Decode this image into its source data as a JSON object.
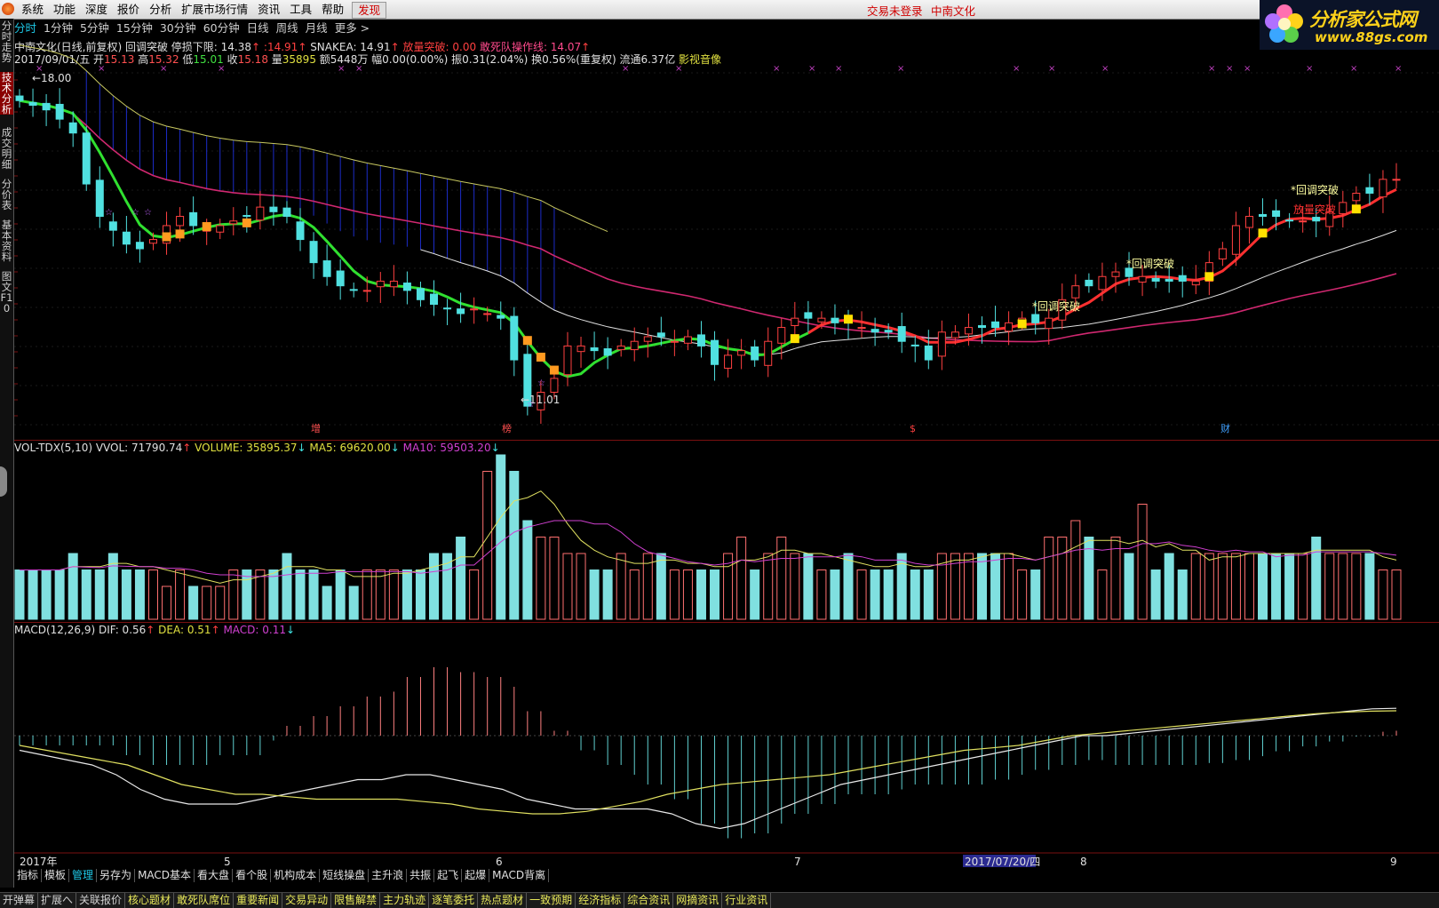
{
  "menu": [
    "系统",
    "功能",
    "深度",
    "报价",
    "分析",
    "扩展市场行情",
    "资讯",
    "工具",
    "帮助"
  ],
  "menu_hot": "发现",
  "notice": "交易未登录",
  "stock_name": "中南文化",
  "brand": {
    "title": "分析家公式网",
    "url": "www.88gs.com"
  },
  "left_tabs": [
    "分时走势",
    "技术分析",
    "成交明细",
    "分价表",
    "基本资料",
    "图文F10"
  ],
  "period_tabs": [
    "分时",
    "1分钟",
    "5分钟",
    "15分钟",
    "30分钟",
    "60分钟",
    "日线",
    "周线",
    "月线",
    "更多 >"
  ],
  "period_active": 0,
  "info1": [
    {
      "t": "中南文化(日线,前复权) 回调突破  停损下限: 14.38",
      "c": "#e0e0e0"
    },
    {
      "t": "↑",
      "c": "#ff4040"
    },
    {
      "t": "  :14.91",
      "c": "#ff4040"
    },
    {
      "t": "↑",
      "c": "#ff4040"
    },
    {
      "t": "   SNAKEA: 14.91",
      "c": "#e0e0e0"
    },
    {
      "t": "↑",
      "c": "#ff4040"
    },
    {
      "t": "          放量突破: 0.00",
      "c": "#ff4040"
    },
    {
      "t": "     敢死队操作线: 14.07",
      "c": "#ff4a8c"
    },
    {
      "t": "↑",
      "c": "#ff4040"
    }
  ],
  "info2": [
    {
      "t": "2017/09/01/五 开",
      "c": "#e0e0e0"
    },
    {
      "t": "15.13",
      "c": "#ff5050"
    },
    {
      "t": " 高",
      "c": "#e0e0e0"
    },
    {
      "t": "15.32",
      "c": "#ff5050"
    },
    {
      "t": " 低",
      "c": "#e0e0e0"
    },
    {
      "t": "15.01",
      "c": "#40e040"
    },
    {
      "t": " 收",
      "c": "#e0e0e0"
    },
    {
      "t": "15.18",
      "c": "#ff5050"
    },
    {
      "t": " 量",
      "c": "#e0e0e0"
    },
    {
      "t": "35895",
      "c": "#e0e040"
    },
    {
      "t": " 额5448万 幅0.00(0.00%) 振0.31(2.04%) 换0.56%(重复权) 流通6.37亿 ",
      "c": "#e0e0e0"
    },
    {
      "t": "影视音像",
      "c": "#e0e040"
    }
  ],
  "vol_label": [
    {
      "t": "VOL-TDX(5,10)  VVOL: 71790.74",
      "c": "#e0e0e0"
    },
    {
      "t": "↑",
      "c": "#ff4040"
    },
    {
      "t": "     VOLUME: 35895.37",
      "c": "#e0e040"
    },
    {
      "t": "↓",
      "c": "#40e0e0"
    },
    {
      "t": "   MA5: 69620.00",
      "c": "#e0e040"
    },
    {
      "t": "↓",
      "c": "#40e0e0"
    },
    {
      "t": "   MA10: 59503.20",
      "c": "#d040d0"
    },
    {
      "t": "↓",
      "c": "#40e0e0"
    }
  ],
  "macd_label": [
    {
      "t": "MACD(12,26,9)  DIF: 0.56",
      "c": "#e0e0e0"
    },
    {
      "t": "↑",
      "c": "#ff4040"
    },
    {
      "t": "   DEA: 0.51",
      "c": "#e0e040"
    },
    {
      "t": "↑",
      "c": "#ff4040"
    },
    {
      "t": "   MACD: 0.11",
      "c": "#d040d0"
    },
    {
      "t": "↓",
      "c": "#40e0e0"
    }
  ],
  "annotations": {
    "high": "18.00",
    "low": "11.01",
    "signal": "回调突破",
    "signal2": "放量突破"
  },
  "event_marks": [
    "增",
    "榜",
    "$",
    "财"
  ],
  "dates": [
    "2017年",
    "5",
    "6",
    "7",
    "2017/07/20/四",
    "8",
    "9"
  ],
  "bottom_tabs": [
    "指标",
    "模板",
    "管理",
    "另存为",
    "MACD基本",
    "看大盘",
    "看个股",
    "机构成本",
    "短线操盘",
    "主升浪",
    "共振",
    "起飞",
    "起爆",
    "MACD背离"
  ],
  "bottom_active": 2,
  "status_tabs": [
    "开弹幕",
    "扩展へ",
    "关联报价",
    "核心题材",
    "敢死队席位",
    "重要新闻",
    "交易异动",
    "限售解禁",
    "主力轨迹",
    "逐笔委托",
    "热点题材",
    "一致预期",
    "经济指标",
    "综合资讯",
    "网摘资讯",
    "行业资讯"
  ],
  "chart_data": {
    "type": "candlestick",
    "period": "日线",
    "date_range": [
      "2017年4月",
      "2017/09/01"
    ],
    "high_marker": 18.0,
    "low_marker": 11.01,
    "last": {
      "open": 15.13,
      "high": 15.32,
      "low": 15.01,
      "close": 15.18,
      "volume": 35895
    },
    "closes": [
      17.6,
      17.5,
      17.4,
      17.2,
      16.9,
      15.8,
      15.1,
      14.8,
      14.5,
      14.4,
      14.6,
      14.9,
      15.1,
      14.9,
      14.8,
      14.9,
      15.0,
      15.1,
      15.3,
      15.2,
      15.1,
      14.6,
      14.1,
      13.8,
      13.6,
      13.5,
      13.5,
      13.7,
      13.7,
      13.5,
      13.3,
      13.2,
      13.1,
      13.0,
      13.1,
      13.0,
      12.9,
      12.0,
      11.0,
      11.3,
      11.6,
      12.3,
      12.3,
      12.2,
      12.1,
      12.3,
      12.4,
      12.5,
      12.5,
      12.4,
      12.5,
      12.3,
      11.9,
      12.1,
      12.2,
      12.0,
      12.4,
      12.7,
      12.9,
      12.9,
      12.9,
      12.8,
      12.8,
      12.7,
      12.6,
      12.6,
      12.4,
      12.3,
      12.0,
      12.6,
      12.6,
      12.7,
      12.7,
      12.7,
      12.8,
      12.9,
      12.8,
      12.9,
      13.3,
      13.6,
      13.6,
      13.8,
      13.9,
      13.8,
      13.8,
      13.7,
      13.7,
      13.7,
      13.7,
      14.1,
      14.4,
      14.9,
      15.1,
      15.1,
      15.1,
      15.0,
      15.0,
      15.0,
      15.2,
      15.4,
      15.6,
      15.6,
      15.9,
      15.9
    ],
    "volumes": [
      3,
      3,
      3,
      3,
      4,
      3,
      3,
      4,
      3,
      3,
      3,
      2,
      3,
      2,
      2,
      2,
      3,
      3,
      3,
      3,
      4,
      3,
      3,
      2,
      3,
      2,
      3,
      3,
      3,
      3,
      3,
      4,
      4,
      5,
      3,
      9,
      10,
      9,
      6,
      5,
      5,
      4,
      4,
      3,
      3,
      4,
      3,
      4,
      4,
      3,
      3,
      3,
      3,
      4,
      5,
      3,
      4,
      5,
      4,
      4,
      3,
      3,
      4,
      3,
      3,
      3,
      4,
      3,
      3,
      4,
      4,
      4,
      4,
      4,
      4,
      3,
      3,
      5,
      5,
      6,
      5,
      3,
      5,
      4,
      7,
      3,
      4,
      3,
      4,
      4,
      4,
      4,
      4,
      4,
      4,
      4,
      4,
      5,
      4,
      4,
      4,
      4,
      3,
      3
    ],
    "dif": [
      -0.3,
      -0.4,
      -0.5,
      -0.6,
      -0.8,
      -1.1,
      -1.3,
      -1.4,
      -1.4,
      -1.4,
      -1.3,
      -1.2,
      -1.1,
      -1.0,
      -0.9,
      -0.9,
      -0.8,
      -0.8,
      -0.9,
      -1.0,
      -1.1,
      -1.3,
      -1.4,
      -1.5,
      -1.5,
      -1.5,
      -1.5,
      -1.6,
      -1.8,
      -1.9,
      -1.8,
      -1.6,
      -1.4,
      -1.2,
      -1.0,
      -0.9,
      -0.8,
      -0.7,
      -0.6,
      -0.5,
      -0.4,
      -0.3,
      -0.2,
      -0.1,
      0.0,
      0.0,
      0.05,
      0.1,
      0.15,
      0.2,
      0.25,
      0.3,
      0.35,
      0.4,
      0.45,
      0.5,
      0.55,
      0.56
    ],
    "dea": [
      -0.2,
      -0.3,
      -0.4,
      -0.5,
      -0.6,
      -0.8,
      -1.0,
      -1.1,
      -1.2,
      -1.2,
      -1.25,
      -1.3,
      -1.3,
      -1.3,
      -1.3,
      -1.35,
      -1.4,
      -1.5,
      -1.55,
      -1.6,
      -1.6,
      -1.55,
      -1.45,
      -1.35,
      -1.2,
      -1.1,
      -1.0,
      -0.95,
      -0.9,
      -0.85,
      -0.8,
      -0.7,
      -0.6,
      -0.5,
      -0.4,
      -0.3,
      -0.25,
      -0.2,
      -0.1,
      0.0,
      0.05,
      0.1,
      0.15,
      0.2,
      0.25,
      0.3,
      0.35,
      0.4,
      0.45,
      0.48,
      0.5,
      0.51
    ]
  }
}
